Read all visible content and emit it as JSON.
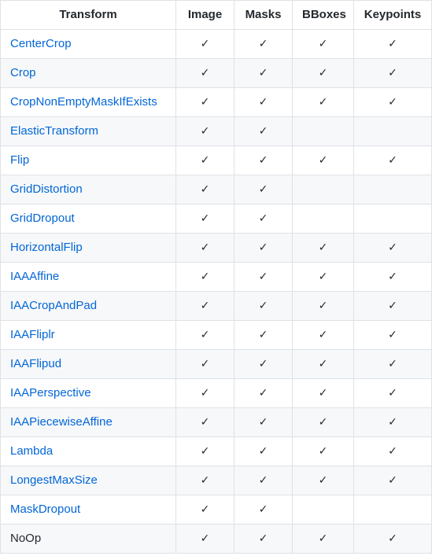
{
  "table": {
    "headers": [
      "Transform",
      "Image",
      "Masks",
      "BBoxes",
      "Keypoints"
    ],
    "check_glyph": "✓",
    "rows": [
      {
        "name": "CenterCrop",
        "link": true,
        "image": "✓",
        "masks": "✓",
        "bboxes": "✓",
        "keypoints": "✓"
      },
      {
        "name": "Crop",
        "link": true,
        "image": "✓",
        "masks": "✓",
        "bboxes": "✓",
        "keypoints": "✓"
      },
      {
        "name": "CropNonEmptyMaskIfExists",
        "link": true,
        "image": "✓",
        "masks": "✓",
        "bboxes": "✓",
        "keypoints": "✓"
      },
      {
        "name": "ElasticTransform",
        "link": true,
        "image": "✓",
        "masks": "✓",
        "bboxes": "",
        "keypoints": ""
      },
      {
        "name": "Flip",
        "link": true,
        "image": "✓",
        "masks": "✓",
        "bboxes": "✓",
        "keypoints": "✓"
      },
      {
        "name": "GridDistortion",
        "link": true,
        "image": "✓",
        "masks": "✓",
        "bboxes": "",
        "keypoints": ""
      },
      {
        "name": "GridDropout",
        "link": true,
        "image": "✓",
        "masks": "✓",
        "bboxes": "",
        "keypoints": ""
      },
      {
        "name": "HorizontalFlip",
        "link": true,
        "image": "✓",
        "masks": "✓",
        "bboxes": "✓",
        "keypoints": "✓"
      },
      {
        "name": "IAAAffine",
        "link": true,
        "image": "✓",
        "masks": "✓",
        "bboxes": "✓",
        "keypoints": "✓"
      },
      {
        "name": "IAACropAndPad",
        "link": true,
        "image": "✓",
        "masks": "✓",
        "bboxes": "✓",
        "keypoints": "✓"
      },
      {
        "name": "IAAFliplr",
        "link": true,
        "image": "✓",
        "masks": "✓",
        "bboxes": "✓",
        "keypoints": "✓"
      },
      {
        "name": "IAAFlipud",
        "link": true,
        "image": "✓",
        "masks": "✓",
        "bboxes": "✓",
        "keypoints": "✓"
      },
      {
        "name": "IAAPerspective",
        "link": true,
        "image": "✓",
        "masks": "✓",
        "bboxes": "✓",
        "keypoints": "✓"
      },
      {
        "name": "IAAPiecewiseAffine",
        "link": true,
        "image": "✓",
        "masks": "✓",
        "bboxes": "✓",
        "keypoints": "✓"
      },
      {
        "name": "Lambda",
        "link": true,
        "image": "✓",
        "masks": "✓",
        "bboxes": "✓",
        "keypoints": "✓"
      },
      {
        "name": "LongestMaxSize",
        "link": true,
        "image": "✓",
        "masks": "✓",
        "bboxes": "✓",
        "keypoints": "✓"
      },
      {
        "name": "MaskDropout",
        "link": true,
        "image": "✓",
        "masks": "✓",
        "bboxes": "",
        "keypoints": ""
      },
      {
        "name": "NoOp",
        "link": false,
        "image": "✓",
        "masks": "✓",
        "bboxes": "✓",
        "keypoints": "✓"
      }
    ]
  },
  "colors": {
    "link": "#0366d6",
    "text": "#24292e",
    "border": "#dfe2e5",
    "stripe": "#f6f8fa"
  }
}
